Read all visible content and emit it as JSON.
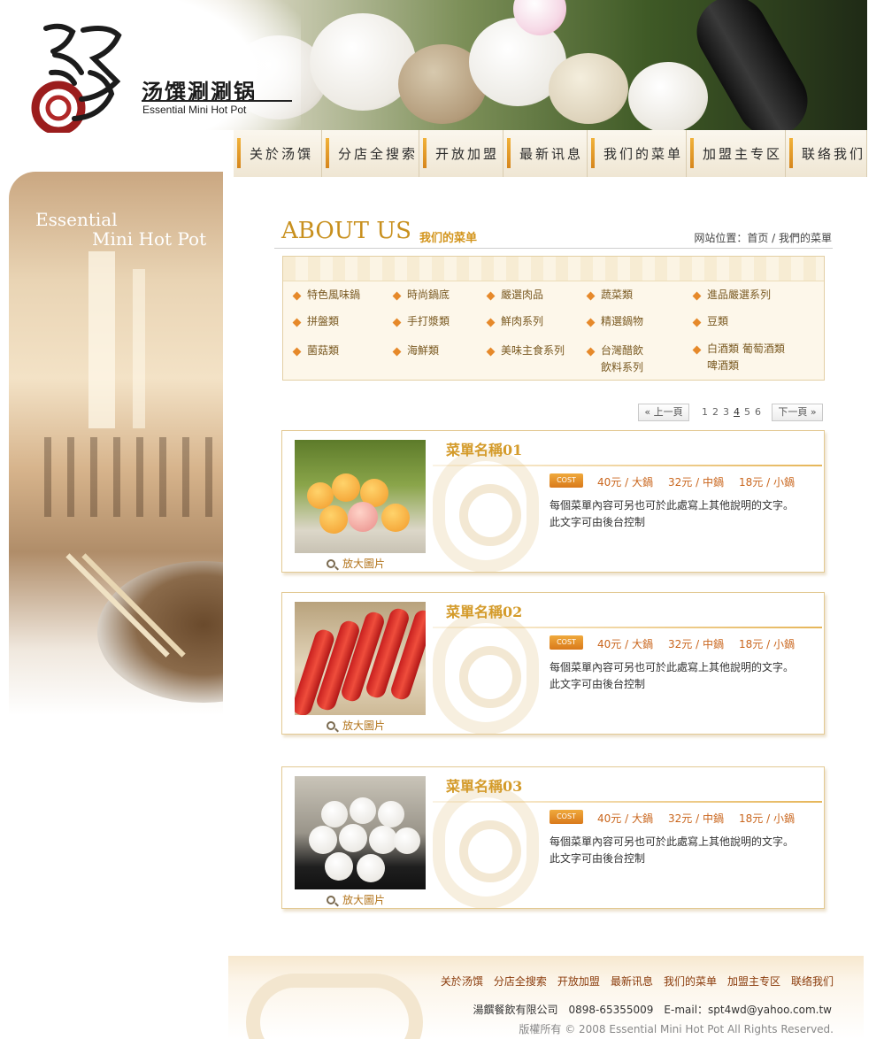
{
  "brand": {
    "name_cn": "汤馔涮涮锅",
    "name_en": "Essential Mini Hot Pot"
  },
  "nav": [
    {
      "label": "关於汤馔"
    },
    {
      "label": "分店全搜索"
    },
    {
      "label": "开放加盟"
    },
    {
      "label": "最新讯息"
    },
    {
      "label": "我们的菜单"
    },
    {
      "label": "加盟主专区"
    },
    {
      "label": "联络我们"
    }
  ],
  "side": {
    "title_line1": "Essential",
    "title_line2": "Mini Hot Pot"
  },
  "page": {
    "heading": "ABOUT US",
    "subheading": "我们的菜单",
    "breadcrumb": "网站位置：首页 / 我們的菜單"
  },
  "categories": [
    "特色風味鍋",
    "時尚鍋底",
    "嚴選肉品",
    "蔬菜類",
    "進品嚴選系列",
    "拼盤類",
    "手打漿類",
    "鮮肉系列",
    "精選鍋物",
    "豆類",
    "菌菇類",
    "海鮮類",
    "美味主食系列",
    "台灣醋飲\n飲料系列",
    "白酒類 葡萄酒類\n啤酒類"
  ],
  "pager": {
    "prev": "« 上一頁",
    "next": "下一頁 »",
    "pages": [
      "1",
      "2",
      "3",
      "4",
      "5",
      "6"
    ],
    "current": "4"
  },
  "menu_items": [
    {
      "title": "菜單名稱01",
      "zoom": "放大圖片",
      "cost_badge": "COST",
      "prices": [
        "40元 / 大鍋",
        "32元 / 中鍋",
        "18元 / 小鍋"
      ],
      "desc_line1": "每個菜單內容可另也可於此處寫上其他說明的文字。",
      "desc_line2": "此文字可由後台控制"
    },
    {
      "title": "菜單名稱02",
      "zoom": "放大圖片",
      "cost_badge": "COST",
      "prices": [
        "40元 / 大鍋",
        "32元 / 中鍋",
        "18元 / 小鍋"
      ],
      "desc_line1": "每個菜單內容可另也可於此處寫上其他說明的文字。",
      "desc_line2": "此文字可由後台控制"
    },
    {
      "title": "菜單名稱03",
      "zoom": "放大圖片",
      "cost_badge": "COST",
      "prices": [
        "40元 / 大鍋",
        "32元 / 中鍋",
        "18元 / 小鍋"
      ],
      "desc_line1": "每個菜單內容可另也可於此處寫上其他說明的文字。",
      "desc_line2": "此文字可由後台控制"
    }
  ],
  "footer": {
    "links": [
      "关於汤馔",
      "分店全搜索",
      "开放加盟",
      "最新讯息",
      "我们的菜单",
      "加盟主专区",
      "联络我们"
    ],
    "contact": "湯饌餐飲有限公司　0898-65355009　E-mail：spt4wd@yahoo.com.tw",
    "copyright": "版權所有 © 2008 Essential Mini Hot Pot  All Rights Reserved."
  },
  "colors": {
    "accent_gold": "#d49b2a",
    "nav_bar": "#e4a232",
    "price_orange": "#c9651c",
    "footer_link": "#8a3b0b"
  }
}
